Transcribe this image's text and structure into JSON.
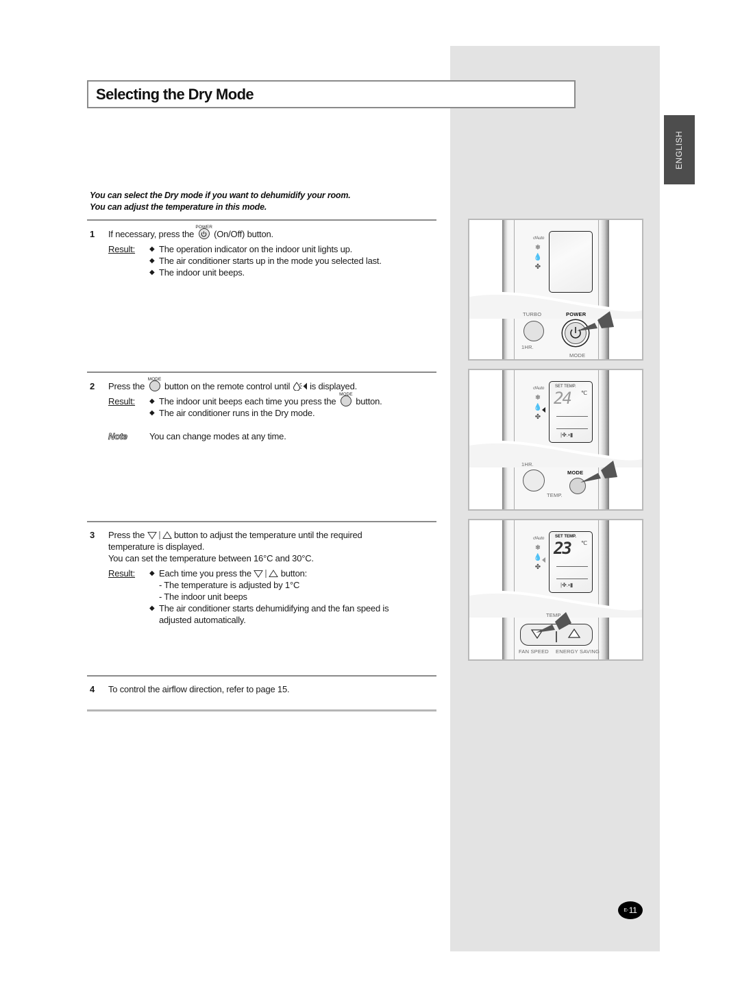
{
  "page": {
    "title": "Selecting the Dry Mode",
    "language_tab": "ENGLISH",
    "page_number_prefix": "E-",
    "page_number": "11"
  },
  "intro": {
    "line1": "You can select the Dry mode if you want to dehumidify your room.",
    "line2": "You can adjust the temperature in this mode."
  },
  "labels": {
    "result": "Result:",
    "note": "Note"
  },
  "steps": [
    {
      "number": "1",
      "text_before": "If necessary, press the",
      "button_caption": "POWER",
      "text_after": "(On/Off) button.",
      "results": [
        "The operation indicator on the indoor unit lights up.",
        "The air conditioner starts up in the mode you selected last.",
        "The indoor unit beeps."
      ]
    },
    {
      "number": "2",
      "text_before": "Press the",
      "button_caption": "MODE",
      "text_middle": "button on the remote control until",
      "text_after": "is displayed.",
      "results": [
        {
          "before": "The indoor unit beeps each time you press the",
          "caption": "MODE",
          "after": "button."
        },
        "The air conditioner runs in the Dry mode."
      ],
      "note": "You can change modes at any time."
    },
    {
      "number": "3",
      "text_before": "Press the",
      "text_after": "button to adjust the temperature until the required",
      "line2": "temperature is displayed.",
      "line3": "You can set the temperature between 16°C and 30°C.",
      "results": [
        {
          "before": "Each time you press the",
          "after": "button:"
        },
        "- The temperature is adjusted by 1°C",
        "- The indoor unit beeps",
        "The air conditioner starts dehumidifying and the fan speed is",
        "adjusted automatically."
      ]
    },
    {
      "number": "4",
      "text": "To control the airflow direction, refer to page 15."
    }
  ],
  "illustrations": [
    {
      "name": "power-illustration",
      "lcd_visible": false,
      "buttons": {
        "left": "TURBO",
        "right": "POWER",
        "bottom_left": "1HR.",
        "bottom_right": "MODE"
      }
    },
    {
      "name": "mode-illustration",
      "lcd": {
        "label": "SET TEMP.",
        "temperature": "24",
        "unit": "℃"
      },
      "buttons": {
        "left": "1HR.",
        "right": "MODE",
        "bottom": "TEMP."
      }
    },
    {
      "name": "temp-illustration",
      "lcd": {
        "label": "SET TEMP.",
        "temperature": "23",
        "unit": "℃"
      },
      "buttons": {
        "label": "TEMP",
        "bottom_left": "FAN SPEED",
        "bottom_right": "ENERGY SAVING"
      }
    }
  ],
  "mode_icon_labels": [
    "Auto",
    "Cool",
    "Dry",
    "Fan"
  ]
}
